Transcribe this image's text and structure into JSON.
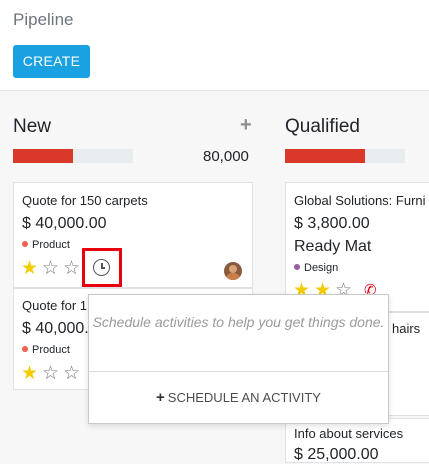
{
  "breadcrumb": "Pipeline",
  "create_button": "CREATE",
  "colors": {
    "primary": "#1aa1e1",
    "progress_red": "#d9382a",
    "star_gold": "#f3cc00",
    "highlight": "#e8000f"
  },
  "columns": [
    {
      "title": "New",
      "add_icon": "plus-icon",
      "amount": "80,000",
      "progress_fraction": 0.5,
      "cards": [
        {
          "title": "Quote for 150 carpets",
          "price": "$ 40,000.00",
          "tag": "Product",
          "tag_color": "#f06050",
          "stars": 1,
          "max_stars": 3,
          "activity_icon": "clock-icon",
          "avatar": "avatar"
        },
        {
          "title": "Quote for 1",
          "price": "$ 40,000.",
          "tag": "Product",
          "tag_color": "#f06050",
          "stars": 1,
          "max_stars": 3
        }
      ]
    },
    {
      "title": "Qualified",
      "amount": "",
      "progress_fraction": 0.67,
      "cards": [
        {
          "title": "Global Solutions: Furni",
          "price": "$ 3,800.00",
          "subtitle": "Ready Mat",
          "tag": "Design",
          "tag_color": "#9c5aa6",
          "stars": 2,
          "max_stars": 3,
          "phone_icon": "phone-icon"
        },
        {
          "title": "hairs",
          "partial": true
        },
        {
          "title": "Info about services",
          "price": "$ 25,000.00"
        }
      ]
    }
  ],
  "popover": {
    "message": "Schedule activities to help you get things done.",
    "button_label": "SCHEDULE AN ACTIVITY",
    "button_icon": "plus-icon"
  }
}
